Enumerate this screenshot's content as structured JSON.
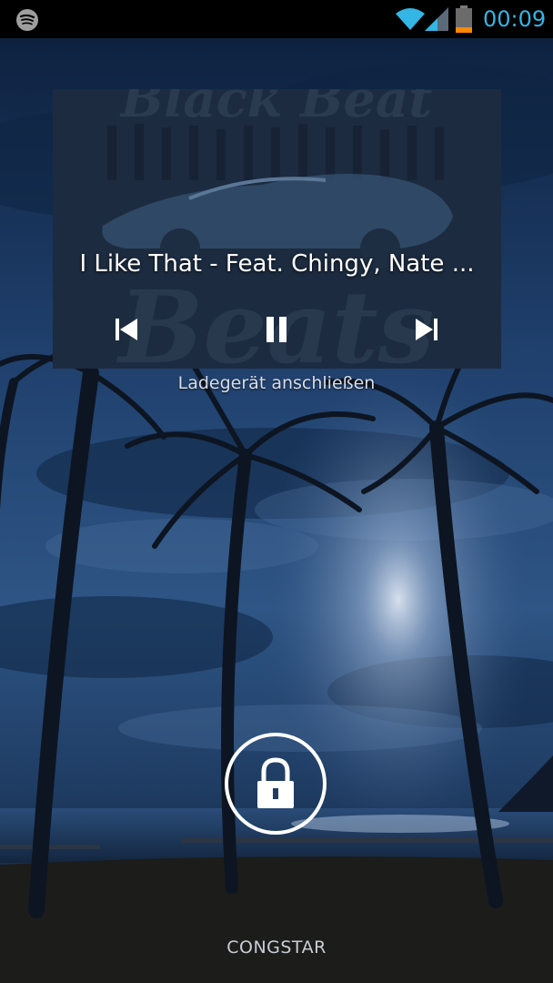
{
  "status_bar": {
    "time": "00:09",
    "icons": [
      "spotify-icon",
      "wifi-icon",
      "signal-icon",
      "battery-icon"
    ],
    "accent_color": "#33b5e5",
    "battery_low_color": "#ff8800"
  },
  "music_widget": {
    "album_art_text": "Black Beat Beats",
    "song_title": "I Like That - Feat. Chingy, Nate ...",
    "controls": {
      "previous": "previous-icon",
      "pause": "pause-icon",
      "next": "next-icon"
    }
  },
  "lockscreen": {
    "charging_message": "Ladegerät anschließen",
    "unlock_icon": "lock-icon",
    "carrier": "CONGSTAR"
  },
  "colors": {
    "sky_dark": "#0b1d3a",
    "sky_mid": "#274a78",
    "moon_glow": "#c8d4e6",
    "ground": "#1a1a18"
  }
}
